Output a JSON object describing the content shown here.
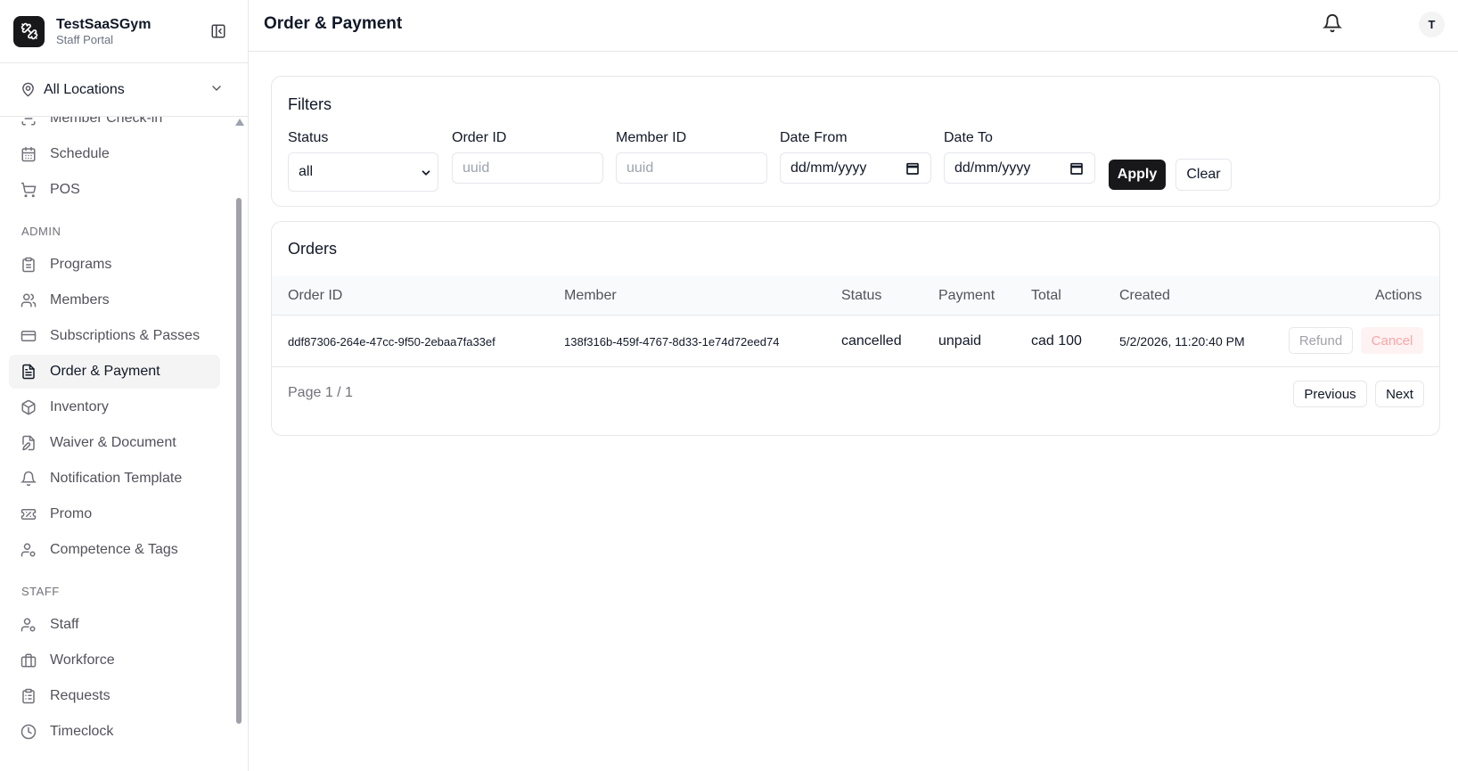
{
  "app": {
    "name": "TestSaaSGym",
    "subtitle": "Staff Portal"
  },
  "location": {
    "selected": "All Locations"
  },
  "sidebar": {
    "items": [
      {
        "label": "Member Check-in",
        "icon": "check-in-icon"
      },
      {
        "label": "Schedule",
        "icon": "calendar-icon"
      },
      {
        "label": "POS",
        "icon": "cart-icon"
      },
      {
        "label": "Programs",
        "icon": "clipboard-icon"
      },
      {
        "label": "Members",
        "icon": "users-icon"
      },
      {
        "label": "Subscriptions & Passes",
        "icon": "credit-card-icon"
      },
      {
        "label": "Order & Payment",
        "icon": "receipt-icon",
        "active": true
      },
      {
        "label": "Inventory",
        "icon": "package-icon"
      },
      {
        "label": "Waiver & Document",
        "icon": "file-edit-icon"
      },
      {
        "label": "Notification Template",
        "icon": "bell-icon"
      },
      {
        "label": "Promo",
        "icon": "ticket-icon"
      },
      {
        "label": "Competence & Tags",
        "icon": "user-tag-icon"
      },
      {
        "label": "Staff",
        "icon": "user-cog-icon"
      },
      {
        "label": "Workforce",
        "icon": "briefcase-icon"
      },
      {
        "label": "Requests",
        "icon": "clipboard-list-icon"
      },
      {
        "label": "Timeclock",
        "icon": "clock-icon"
      }
    ],
    "sections": {
      "admin": "ADMIN",
      "staff": "STAFF"
    }
  },
  "header": {
    "title": "Order & Payment",
    "avatar_initial": "T"
  },
  "filters": {
    "title": "Filters",
    "status": {
      "label": "Status",
      "value": "all"
    },
    "order_id": {
      "label": "Order ID",
      "placeholder": "uuid"
    },
    "member_id": {
      "label": "Member ID",
      "placeholder": "uuid"
    },
    "date_from": {
      "label": "Date From",
      "value": "dd/mm/yyyy"
    },
    "date_to": {
      "label": "Date To",
      "value": "dd/mm/yyyy"
    },
    "apply": "Apply",
    "clear": "Clear"
  },
  "orders": {
    "title": "Orders",
    "columns": [
      "Order ID",
      "Member",
      "Status",
      "Payment",
      "Total",
      "Created",
      "Actions"
    ],
    "rows": [
      {
        "order_id": "ddf87306-264e-47cc-9f50-2ebaa7fa33ef",
        "member": "138f316b-459f-4767-8d33-1e74d72eed74",
        "status": "cancelled",
        "payment": "unpaid",
        "total": "cad 100",
        "created": "5/2/2026, 11:20:40 PM",
        "refund": "Refund",
        "cancel": "Cancel"
      }
    ],
    "pager": {
      "text": "Page 1 / 1",
      "previous": "Previous",
      "next": "Next"
    }
  },
  "colors": {
    "primary": "#18181b",
    "danger_bg": "#fef2f2",
    "danger_text": "#fca5a5",
    "active_bg": "#f4f4f5"
  }
}
